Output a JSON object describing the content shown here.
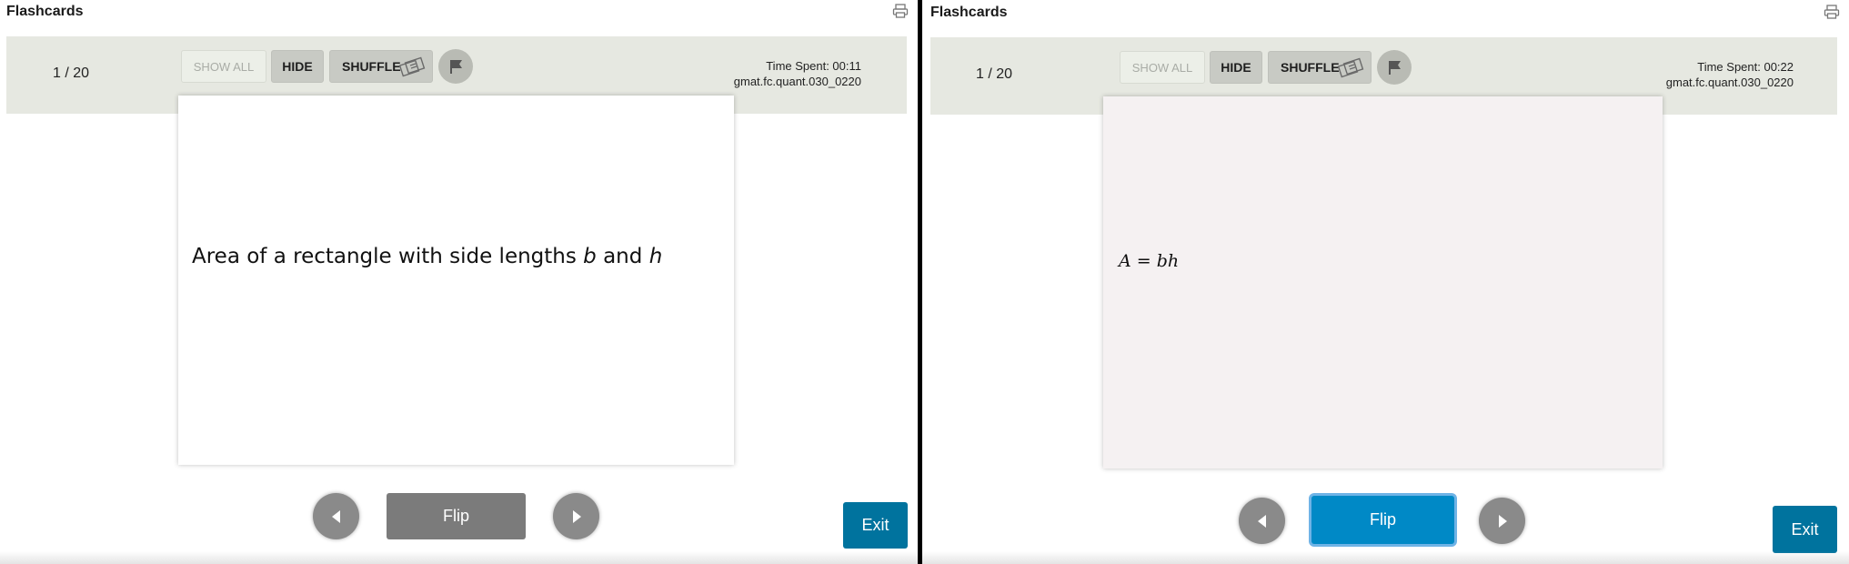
{
  "left_panel": {
    "app_title": "Flashcards",
    "counter": "1 / 20",
    "buttons": {
      "show_all": "SHOW ALL",
      "hide": "HIDE",
      "shuffle": "SHUFFLE",
      "flip": "Flip",
      "exit": "Exit"
    },
    "time_spent": "Time Spent: 00:11",
    "card_id": "gmat.fc.quant.030_0220",
    "card_face": "front",
    "card_text": {
      "prefix": "Area of a rectangle with side lengths ",
      "var1": "b",
      "middle": " and ",
      "var2": "h"
    },
    "icons": [
      "printer-icon",
      "shuffle-cards-icon",
      "flag-icon",
      "arrow-left-icon",
      "arrow-right-icon"
    ]
  },
  "right_panel": {
    "app_title": "Flashcards",
    "counter": "1 / 20",
    "buttons": {
      "show_all": "SHOW ALL",
      "hide": "HIDE",
      "shuffle": "SHUFFLE",
      "flip": "Flip",
      "exit": "Exit"
    },
    "time_spent": "Time Spent: 00:22",
    "card_id": "gmat.fc.quant.030_0220",
    "card_face": "back",
    "card_math": {
      "lhs": "A",
      "eq": " = ",
      "rhs": "bh"
    },
    "flip_focused": true,
    "icons": [
      "printer-icon",
      "shuffle-cards-icon",
      "flag-icon",
      "arrow-left-icon",
      "arrow-right-icon"
    ]
  },
  "colors": {
    "toolbar_bg": "#e6e8e1",
    "exit_button": "#00739e",
    "flip_active": "#0089c6",
    "flip_inactive": "#7b7b7b",
    "nav_circle": "#8a8a8a",
    "divider": "#000000"
  }
}
